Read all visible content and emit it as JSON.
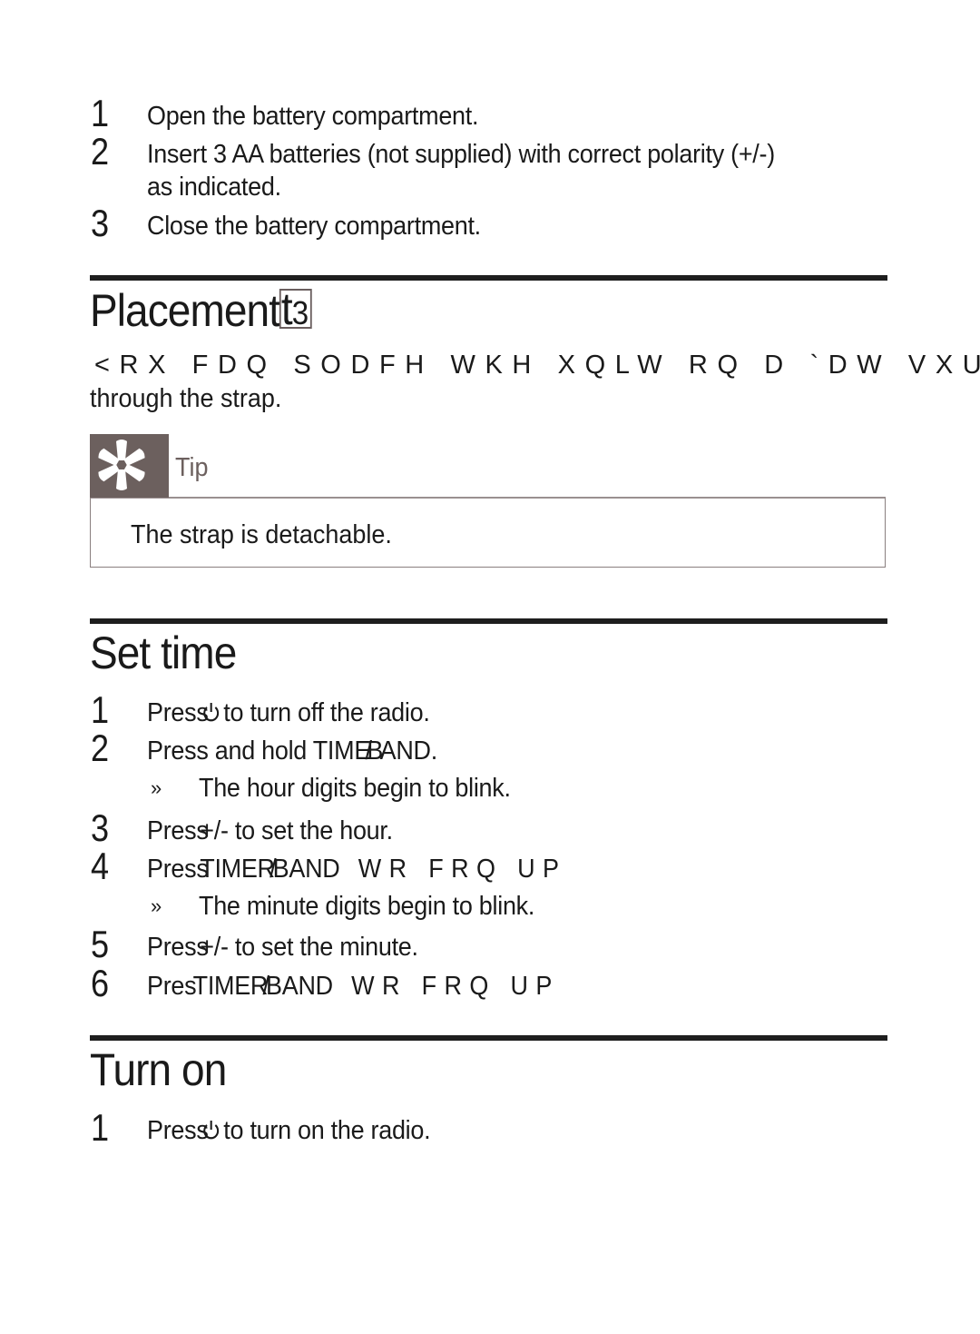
{
  "battery_steps": [
    {
      "num": "1",
      "text": "Open the battery compartment."
    },
    {
      "num": "2",
      "text": "Insert 3 AA batteries (not supplied) with correct polarity (+/-)",
      "text_line2": "as indicated."
    },
    {
      "num": "3",
      "text": "Close the battery compartment."
    }
  ],
  "placement": {
    "heading": "Placement",
    "heading_last_char": "t",
    "heading_boxed_glyph": "3",
    "body_garbled": "<RX FDQ SODFH WKH XQLW RQ D `DW VXUI",
    "body_line2": "through the strap.",
    "tip": {
      "label": "Tip",
      "icon": "asterisk-tip-icon",
      "text": "The strap is detachable."
    }
  },
  "set_time": {
    "heading": "Set time",
    "steps": [
      {
        "num": "1",
        "prefix": "Press",
        "icon": "power-icon",
        "suffix": "to turn off the radio."
      },
      {
        "num": "2",
        "text": "Press and hold TIME",
        "overlap": "/B",
        "text_end": "AND."
      },
      {
        "num": "3",
        "prefix": "Press",
        "key": "+/-",
        "suffix": "to set the hour."
      },
      {
        "num": "4",
        "prefix": "Press",
        "key": "TIMER",
        "slash": "/",
        "key2": "BAND",
        "garbled": "WR FRQ UP"
      },
      {
        "num": "5",
        "prefix": "Press",
        "key": "+/-",
        "suffix": "to set the minute."
      },
      {
        "num": "6",
        "prefix": "Pres",
        "key": "TIMER",
        "slash": "/",
        "key2": "BAND",
        "garbled": "WR FRQ UP"
      }
    ],
    "results": [
      {
        "marker": "»",
        "text": "The hour digits begin to blink."
      },
      {
        "marker": "»",
        "text": "The minute digits begin to blink."
      }
    ]
  },
  "turn_on": {
    "heading": "Turn on",
    "steps": [
      {
        "num": "1",
        "prefix": "Press",
        "icon": "power-icon",
        "suffix": "to turn on the radio."
      }
    ]
  },
  "colors": {
    "tip_accent": "#6c605e",
    "rule": "#1e1e1e",
    "text": "#1a1a1a"
  }
}
